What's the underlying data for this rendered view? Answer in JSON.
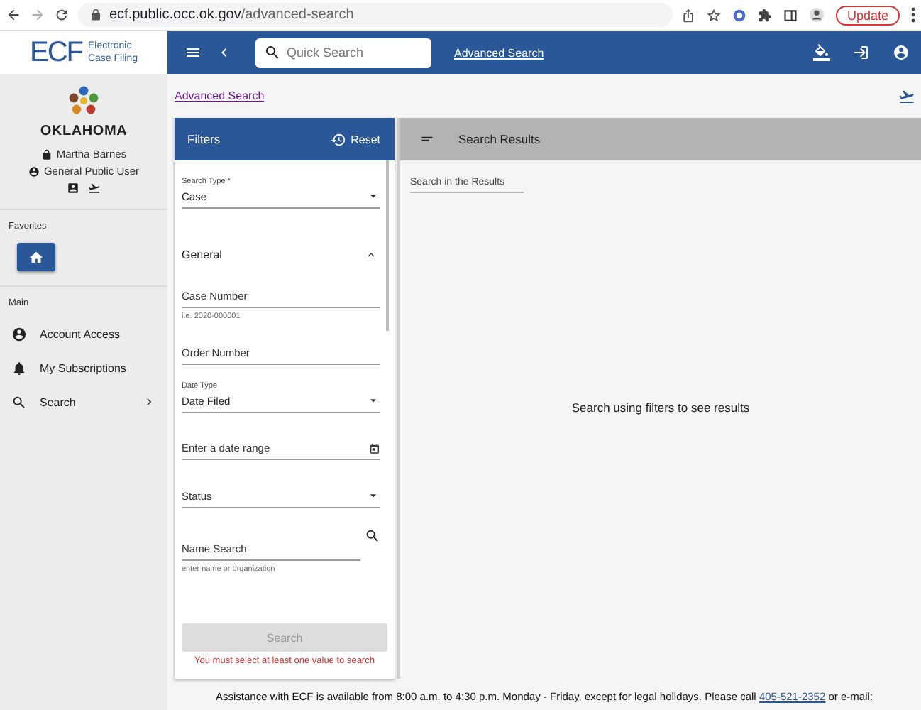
{
  "browser": {
    "url_host": "ecf.public.occ.ok.gov",
    "url_path": "/advanced-search",
    "update_button": "Update"
  },
  "header": {
    "logo_mark": "ECF",
    "logo_line_1": "Electronic",
    "logo_line_2": "Case Filing",
    "search_placeholder": "Quick Search",
    "advanced_link": "Advanced Search"
  },
  "sidebar": {
    "state_name": "OKLAHOMA",
    "user_name": "Martha Barnes",
    "user_role": "General Public User",
    "favorites_heading": "Favorites",
    "main_heading": "Main",
    "items": [
      {
        "label": "Account Access",
        "kind": "account",
        "has_children": false
      },
      {
        "label": "My Subscriptions",
        "kind": "bell",
        "has_children": false
      },
      {
        "label": "Search",
        "kind": "search",
        "has_children": true
      }
    ]
  },
  "breadcrumb": "Advanced Search",
  "filters": {
    "title": "Filters",
    "reset": "Reset",
    "fields": [
      {
        "kind": "select",
        "label": "Search Type *",
        "value": "Case"
      },
      {
        "kind": "section",
        "label": "General",
        "expanded": true
      },
      {
        "kind": "text",
        "placeholder": "Case Number",
        "hint": "i.e. 2020-000001"
      },
      {
        "kind": "text",
        "placeholder": "Order Number"
      },
      {
        "kind": "select",
        "label": "Date Type",
        "value": "Date Filed"
      },
      {
        "kind": "date",
        "placeholder": "Enter a date range"
      },
      {
        "kind": "select",
        "placeholder": "Status"
      },
      {
        "kind": "search",
        "placeholder": "Name Search",
        "hint": "enter name or organization"
      }
    ],
    "search_button": "Search",
    "search_disabled": true,
    "error": "You must select at least one value to search"
  },
  "results": {
    "title": "Search Results",
    "filter_placeholder": "Search in the Results",
    "empty_message": "Search using filters to see results"
  },
  "footer": {
    "text": "Assistance with ECF is available from 8:00 a.m. to 4:30 p.m. Monday - Friday, except for legal holidays. Please call",
    "phone": "405-521-2352",
    "after": "or e-mail:"
  }
}
